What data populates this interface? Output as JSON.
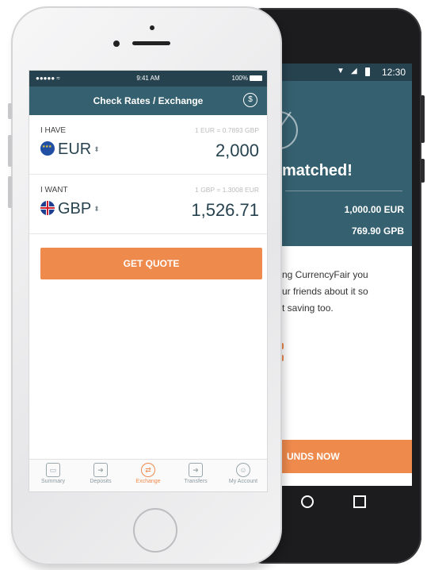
{
  "android": {
    "status_time": "12:30",
    "headline": "matched!",
    "amount_1": "1,000.00 EUR",
    "amount_2": "769.90 GPB",
    "body_line_1": "ng CurrencyFair you",
    "body_line_2": "ur friends about it so",
    "body_line_3": "t saving too.",
    "cta_label": "UNDS NOW"
  },
  "iphone": {
    "status": {
      "carrier": "●●●●● ≈",
      "time": "9:41 AM",
      "battery": "100%"
    },
    "header": {
      "title": "Check Rates / Exchange",
      "dollar_icon": "$"
    },
    "have": {
      "label": "I HAVE",
      "rate": "1 EUR = 0.7893 GBP",
      "currency": "EUR",
      "amount": "2,000"
    },
    "want": {
      "label": "I WANT",
      "rate": "1 GBP = 1.3008 EUR",
      "currency": "GBP",
      "amount": "1,526.71"
    },
    "quote_button": "GET QUOTE",
    "tabs": [
      {
        "label": "Summary",
        "icon": "wallet-icon"
      },
      {
        "label": "Deposits",
        "icon": "deposit-icon"
      },
      {
        "label": "Exchange",
        "icon": "exchange-icon"
      },
      {
        "label": "Transfers",
        "icon": "transfer-icon"
      },
      {
        "label": "My Account",
        "icon": "user-icon"
      }
    ],
    "active_tab": "Exchange"
  },
  "colors": {
    "header_teal": "#35606f",
    "status_dark": "#27424f",
    "accent_orange": "#ef8a4d"
  }
}
